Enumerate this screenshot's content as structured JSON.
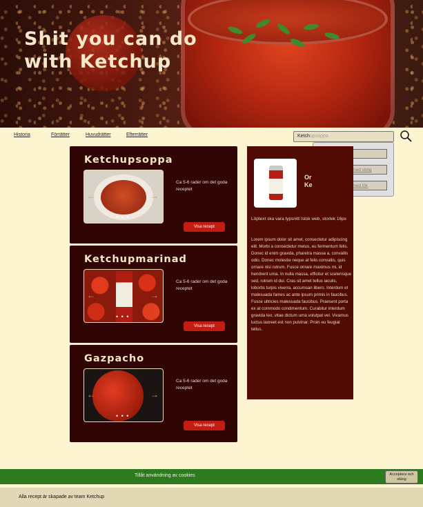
{
  "hero": {
    "title": "Shit you can do with Ketchup"
  },
  "nav": {
    "items": [
      "Historia",
      "Förrätter",
      "Huvudrätter",
      "Efterrätter"
    ]
  },
  "search": {
    "typed": "Ketch",
    "suggestion_rest": "upsoppa",
    "suggestions": [
      "Ketchupsoppa",
      "Ketchupsoppa med sting",
      "Ketchupsoppa med lök"
    ]
  },
  "recipes": [
    {
      "title": "Ketchupsoppa",
      "desc": "Ca 5-6 rader om det goda receptet",
      "button": "Visa recept",
      "dots": "• • •"
    },
    {
      "title": "Ketchupmarinad",
      "desc": "Ca 5-6 rader om det goda receptet",
      "button": "Visa recept",
      "dots": "• • •"
    },
    {
      "title": "Gazpacho",
      "desc": "Ca 5-6 rader om det goda receptet",
      "button": "Visa recept",
      "dots": "• • •"
    }
  ],
  "panel": {
    "heading_line1": "Or",
    "heading_line2": "Ke",
    "lead": "Löptext ska vara typsnitt Istok web, storlek 16px",
    "body": "Lorem ipsum dolor sit amet, consectetur adipiscing elit. Morbi a consectetur metus, eu fermentum felis. Donec id enim gravida, pharetra massa a, convallis odio. Donec molestie neque at felis convallis, quis ornare nisi rutrum. Fusce ornare maximus mi, id hendrerit urna. In nulla massa, efficitur et scelerisque sed, rutrum id dui. Cras sit amet tellus iaculis, lobortis turpis viverra, accumsan libero. Interdum et malesuada fames ac ante ipsum primis in faucibus. Fusce ultricies malesuada faucibus. Praesent porta ex at commodo condimentum. Curabitur interdum gravida leo, vitae dictum urna volutpat vel. Vivamus luctus laoreet est non pulvinar. Proin eu feugiat tellus."
  },
  "cookie": {
    "text": "Tillåt användning av cookies",
    "button": "Acceptera och stäng"
  },
  "footer": {
    "text": "Alla recept är skapade av team Ketchup"
  },
  "colors": {
    "accent": "#c21d10",
    "card_bg": "#320505",
    "panel_bg": "#520a04",
    "cookie_bg": "#2e7a1e",
    "page_bg": "#fdf4d2"
  }
}
